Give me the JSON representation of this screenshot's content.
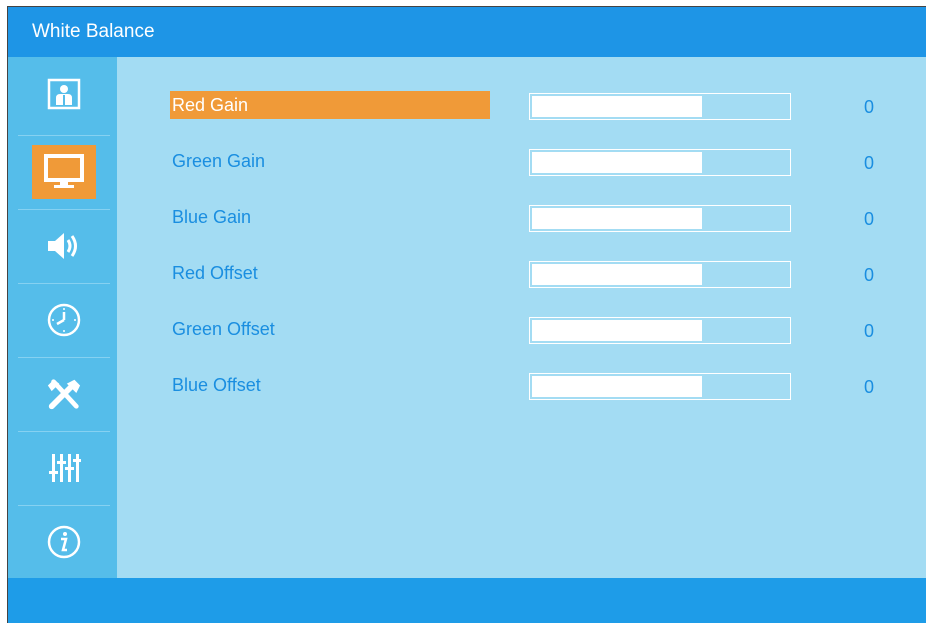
{
  "window": {
    "title": "White Balance"
  },
  "sidebar": {
    "items": [
      {
        "icon": "picture-icon",
        "active": false
      },
      {
        "icon": "monitor-icon",
        "active": true
      },
      {
        "icon": "speaker-icon",
        "active": false
      },
      {
        "icon": "clock-icon",
        "active": false
      },
      {
        "icon": "tools-icon",
        "active": false
      },
      {
        "icon": "equalizer-icon",
        "active": false
      },
      {
        "icon": "info-icon",
        "active": false
      }
    ]
  },
  "settings": [
    {
      "label": "Red Gain",
      "value": "0",
      "level": 0.665,
      "selected": true
    },
    {
      "label": "Green Gain",
      "value": "0",
      "level": 0.665,
      "selected": false
    },
    {
      "label": "Blue Gain",
      "value": "0",
      "level": 0.665,
      "selected": false
    },
    {
      "label": "Red Offset",
      "value": "0",
      "level": 0.665,
      "selected": false
    },
    {
      "label": "Green Offset",
      "value": "0",
      "level": 0.665,
      "selected": false
    },
    {
      "label": "Blue Offset",
      "value": "0",
      "level": 0.665,
      "selected": false
    }
  ],
  "colors": {
    "title_bar": "#1e95e6",
    "sidebar": "#55bdea",
    "panel": "#a3dcf3",
    "accent": "#f09a38",
    "text": "#1a8ee0"
  }
}
